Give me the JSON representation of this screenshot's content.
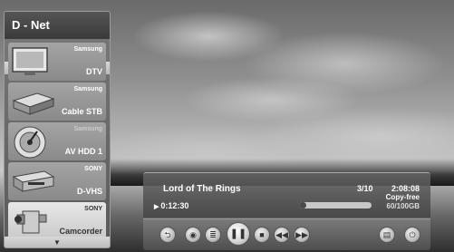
{
  "sidebar": {
    "title": "D - Net",
    "devices": [
      {
        "brand": "Samsung",
        "name": "DTV",
        "icon": "tv-icon"
      },
      {
        "brand": "Samsung",
        "name": "Cable STB",
        "icon": "settop-box-icon"
      },
      {
        "brand": "Samsung",
        "name": "AV HDD 1",
        "icon": "hard-drive-icon"
      },
      {
        "brand": "SONY",
        "name": "D-VHS",
        "icon": "vcr-icon"
      },
      {
        "brand": "SONY",
        "name": "Camcorder",
        "icon": "camcorder-icon",
        "selected": true
      }
    ]
  },
  "player": {
    "title": "Lord of The Rings",
    "elapsed": "0:12:30",
    "track": "3/10",
    "duration": "2:08:08",
    "copy_status": "Copy-free",
    "storage": "60/100GB",
    "progress": 0.1
  },
  "controls": {
    "buttons": [
      "back",
      "record",
      "menu",
      "pause",
      "stop",
      "rewind",
      "fast-forward",
      "info",
      "power"
    ]
  }
}
